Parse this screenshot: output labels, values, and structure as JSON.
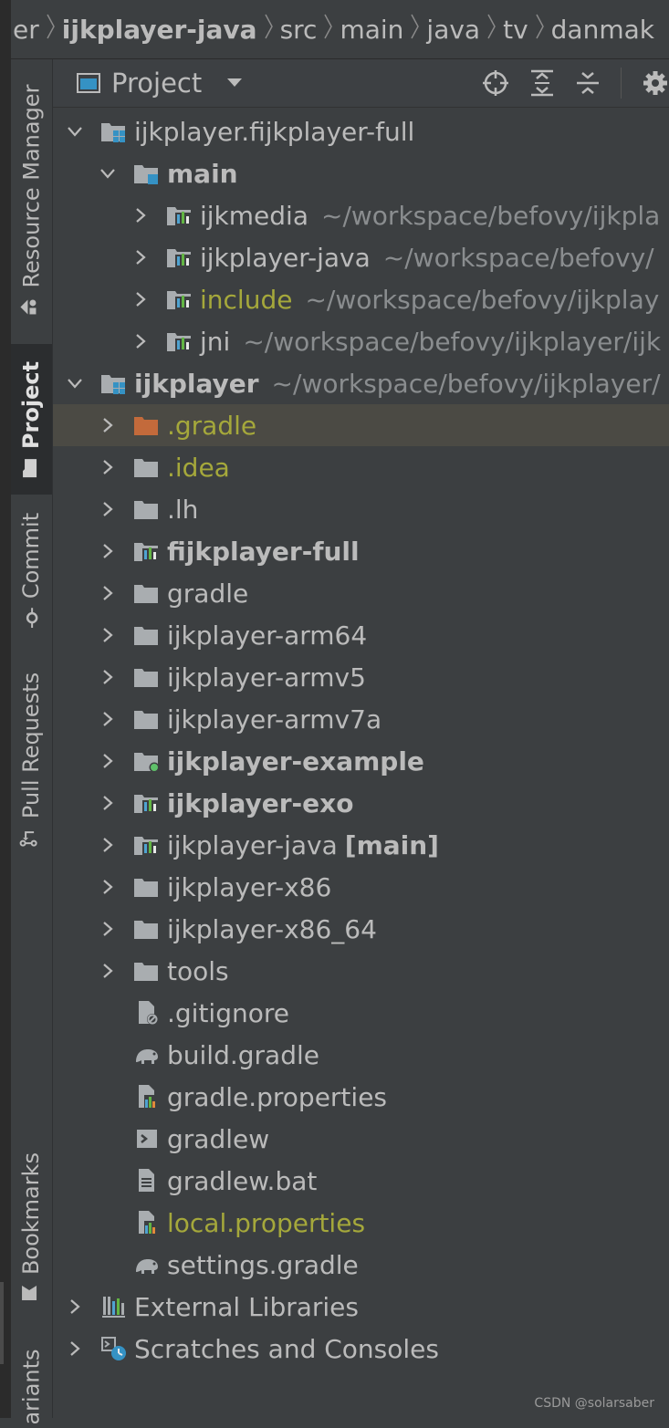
{
  "breadcrumb": [
    "er",
    "ijkplayer-java",
    "src",
    "main",
    "java",
    "tv",
    "danmak"
  ],
  "toolstrip": {
    "resource_manager": "Resource Manager",
    "project": "Project",
    "commit": "Commit",
    "pull_requests": "Pull Requests",
    "bookmarks": "Bookmarks",
    "variants": "ariants"
  },
  "panel": {
    "title": "Project"
  },
  "tree": [
    {
      "label": "ijkplayer.fijkplayer-full",
      "path": "",
      "suffix": "",
      "icon": "module",
      "expanded": true,
      "bold": false,
      "color": "default"
    },
    {
      "label": "main",
      "path": "",
      "suffix": "",
      "icon": "module-folder",
      "expanded": true,
      "bold": true,
      "color": "default"
    },
    {
      "label": "ijkmedia",
      "path": "~/workspace/befovy/ijkpla",
      "suffix": "",
      "icon": "module-chart",
      "expanded": false,
      "bold": false,
      "color": "default"
    },
    {
      "label": "ijkplayer-java",
      "path": "~/workspace/befovy/",
      "suffix": "",
      "icon": "module-chart",
      "expanded": false,
      "bold": false,
      "color": "default"
    },
    {
      "label": "include",
      "path": "~/workspace/befovy/ijkplay",
      "suffix": "",
      "icon": "module-chart",
      "expanded": false,
      "bold": false,
      "color": "olive"
    },
    {
      "label": "jni",
      "path": "~/workspace/befovy/ijkplayer/ijk",
      "suffix": "",
      "icon": "module-chart",
      "expanded": false,
      "bold": false,
      "color": "default"
    },
    {
      "label": "ijkplayer",
      "path": "~/workspace/befovy/ijkplayer/",
      "suffix": "",
      "icon": "module",
      "expanded": true,
      "bold": true,
      "color": "default"
    },
    {
      "label": ".gradle",
      "path": "",
      "suffix": "",
      "icon": "folder-orange",
      "expanded": false,
      "bold": false,
      "color": "olive"
    },
    {
      "label": ".idea",
      "path": "",
      "suffix": "",
      "icon": "folder",
      "expanded": false,
      "bold": false,
      "color": "olive"
    },
    {
      "label": ".lh",
      "path": "",
      "suffix": "",
      "icon": "folder",
      "expanded": false,
      "bold": false,
      "color": "default"
    },
    {
      "label": "fijkplayer-full",
      "path": "",
      "suffix": "",
      "icon": "folder-module",
      "expanded": false,
      "bold": true,
      "color": "default"
    },
    {
      "label": "gradle",
      "path": "",
      "suffix": "",
      "icon": "folder",
      "expanded": false,
      "bold": false,
      "color": "default"
    },
    {
      "label": "ijkplayer-arm64",
      "path": "",
      "suffix": "",
      "icon": "folder",
      "expanded": false,
      "bold": false,
      "color": "default"
    },
    {
      "label": "ijkplayer-armv5",
      "path": "",
      "suffix": "",
      "icon": "folder",
      "expanded": false,
      "bold": false,
      "color": "default"
    },
    {
      "label": "ijkplayer-armv7a",
      "path": "",
      "suffix": "",
      "icon": "folder",
      "expanded": false,
      "bold": false,
      "color": "default"
    },
    {
      "label": "ijkplayer-example",
      "path": "",
      "suffix": "",
      "icon": "folder-app",
      "expanded": false,
      "bold": true,
      "color": "default"
    },
    {
      "label": "ijkplayer-exo",
      "path": "",
      "suffix": "",
      "icon": "folder-module",
      "expanded": false,
      "bold": true,
      "color": "default"
    },
    {
      "label": "ijkplayer-java",
      "path": "",
      "suffix": "[main]",
      "icon": "folder-module",
      "expanded": false,
      "bold": false,
      "color": "default"
    },
    {
      "label": "ijkplayer-x86",
      "path": "",
      "suffix": "",
      "icon": "folder",
      "expanded": false,
      "bold": false,
      "color": "default"
    },
    {
      "label": "ijkplayer-x86_64",
      "path": "",
      "suffix": "",
      "icon": "folder",
      "expanded": false,
      "bold": false,
      "color": "default"
    },
    {
      "label": "tools",
      "path": "",
      "suffix": "",
      "icon": "folder",
      "expanded": false,
      "bold": false,
      "color": "default"
    },
    {
      "label": ".gitignore",
      "path": "",
      "suffix": "",
      "icon": "file-ignore",
      "expanded": null,
      "bold": false,
      "color": "default"
    },
    {
      "label": "build.gradle",
      "path": "",
      "suffix": "",
      "icon": "gradle-elephant",
      "expanded": null,
      "bold": false,
      "color": "default"
    },
    {
      "label": "gradle.properties",
      "path": "",
      "suffix": "",
      "icon": "file-properties",
      "expanded": null,
      "bold": false,
      "color": "default"
    },
    {
      "label": "gradlew",
      "path": "",
      "suffix": "",
      "icon": "file-shell",
      "expanded": null,
      "bold": false,
      "color": "default"
    },
    {
      "label": "gradlew.bat",
      "path": "",
      "suffix": "",
      "icon": "file-text",
      "expanded": null,
      "bold": false,
      "color": "default"
    },
    {
      "label": "local.properties",
      "path": "",
      "suffix": "",
      "icon": "file-properties",
      "expanded": null,
      "bold": false,
      "color": "olive"
    },
    {
      "label": "settings.gradle",
      "path": "",
      "suffix": "",
      "icon": "gradle-elephant",
      "expanded": null,
      "bold": false,
      "color": "default"
    },
    {
      "label": "External Libraries",
      "path": "",
      "suffix": "",
      "icon": "libraries",
      "expanded": false,
      "bold": false,
      "color": "default"
    },
    {
      "label": "Scratches and Consoles",
      "path": "",
      "suffix": "",
      "icon": "scratches",
      "expanded": false,
      "bold": false,
      "color": "default"
    }
  ],
  "colors": {
    "background": "#3c3f41",
    "selected_row": "#4b4a44",
    "olive_text": "#a5a83b",
    "path_text": "#8a8d8f",
    "folder_orange": "#c36a3b",
    "accent_blue": "#3592c4"
  },
  "watermark": "CSDN @solarsaber"
}
